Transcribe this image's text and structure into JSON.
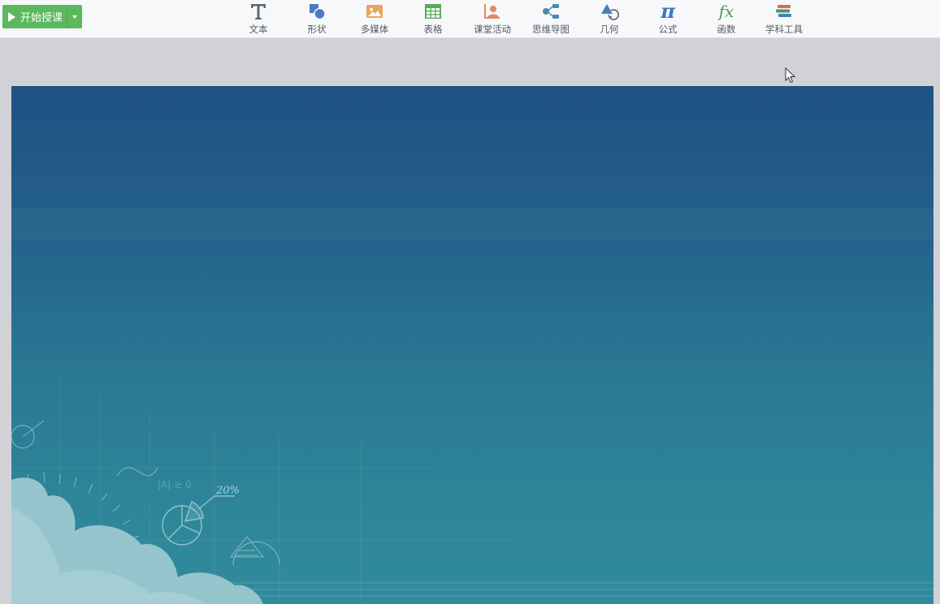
{
  "toolbar": {
    "start_button": {
      "label": "开始授课"
    },
    "tools": [
      {
        "id": "text",
        "label": "文本",
        "icon": "text-t-icon"
      },
      {
        "id": "shape",
        "label": "形状",
        "icon": "shape-icon"
      },
      {
        "id": "media",
        "label": "多媒体",
        "icon": "image-icon"
      },
      {
        "id": "table",
        "label": "表格",
        "icon": "table-icon"
      },
      {
        "id": "activity",
        "label": "课堂活动",
        "icon": "person-activity-icon"
      },
      {
        "id": "mindmap",
        "label": "思维导图",
        "icon": "mindmap-icon"
      },
      {
        "id": "geometry",
        "label": "几何",
        "icon": "geometry-icon"
      },
      {
        "id": "formula",
        "label": "公式",
        "icon": "pi-icon"
      },
      {
        "id": "function",
        "label": "函数",
        "icon": "fx-icon"
      },
      {
        "id": "subject",
        "label": "学科工具",
        "icon": "books-icon"
      }
    ]
  },
  "slide": {
    "deco_text": {
      "percent": "20%",
      "formula1": "|A| ≥ 0"
    }
  },
  "colors": {
    "start_button": "#5cb85c",
    "toolbar_bg": "#f7f8fa",
    "canvas_bg": "#d1d2d7",
    "slide_top": "#1e5283",
    "slide_bottom": "#318b9b"
  }
}
